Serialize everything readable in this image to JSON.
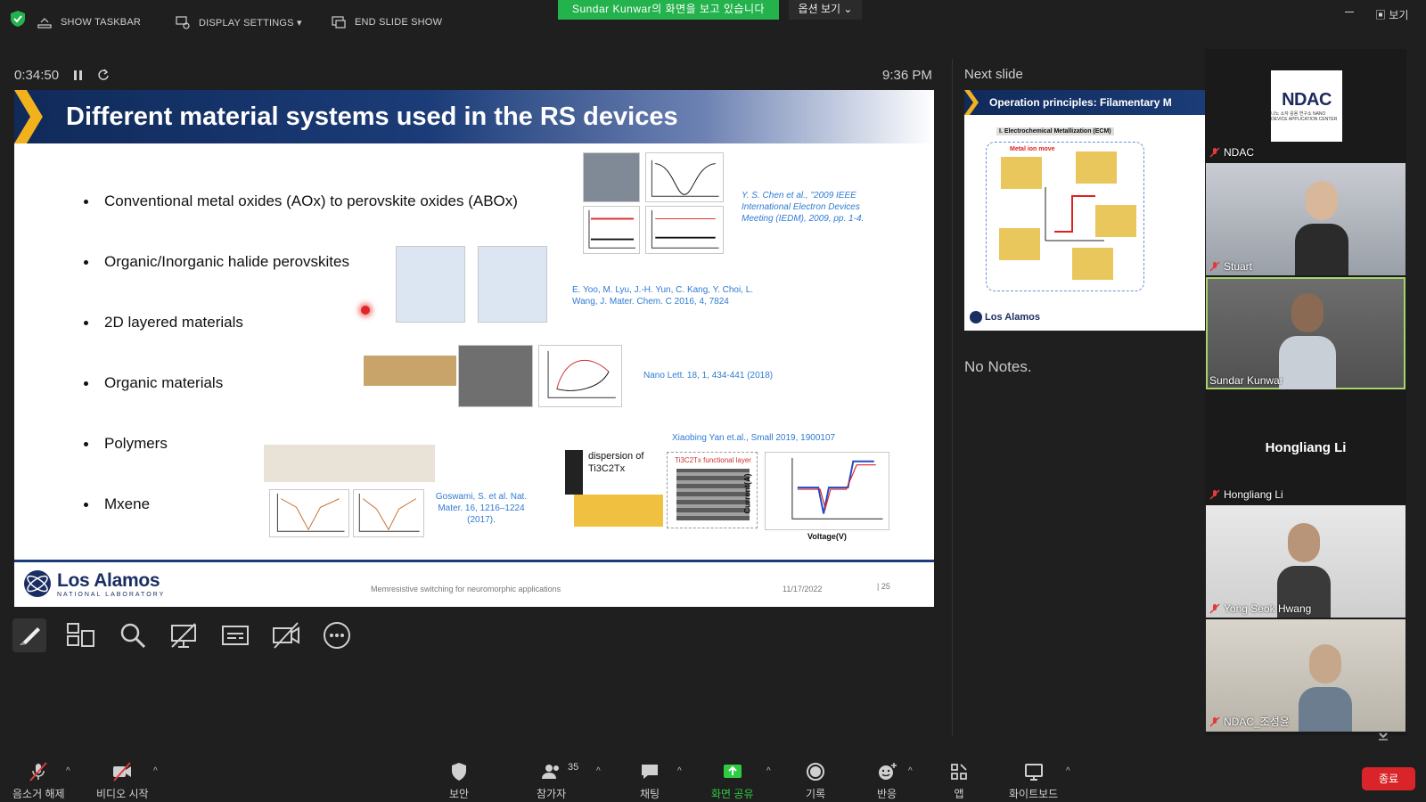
{
  "topbar": {
    "show_taskbar": "SHOW TASKBAR",
    "display_settings": "DISPLAY SETTINGS ▾",
    "end_slide_show": "END SLIDE SHOW",
    "sharing_banner": "Sundar  Kunwar의 화면을 보고 있습니다",
    "view_options": "옵션 보기 ⌄",
    "view_label": "보기"
  },
  "presenter": {
    "elapsed": "0:34:50",
    "clock": "9:36 PM"
  },
  "slide": {
    "title": "Different material systems used in the RS devices",
    "bullets": [
      "Conventional metal oxides (AOx) to perovskite oxides (ABOx)",
      "Organic/Inorganic halide perovskites",
      "2D layered materials",
      "Organic materials",
      "Polymers",
      "Mxene"
    ],
    "citations": {
      "c1": "Y. S. Chen et al., \"2009 IEEE International Electron Devices Meeting (IEDM), 2009, pp. 1-4.",
      "c2": "E. Yoo, M. Lyu, J.-H. Yun, C. Kang, Y. Choi, L. Wang, J. Mater. Chem. C 2016, 4, 7824",
      "c3": "Nano Lett. 18, 1, 434-441 (2018)",
      "c4": "Xiaobing Yan et.al., Small 2019, 1900107",
      "c5": "Goswami, S. et al. Nat. Mater. 16, 1216–1224 (2017)."
    },
    "figure_labels": {
      "dispersion": "dispersion of Ti3C2Tx",
      "functional_layer": "Ti3C2Tx functional layer",
      "voltage_axis": "Voltage(V)",
      "current_axis": "Current(A)"
    },
    "footer": {
      "org": "Los Alamos",
      "org_sub": "NATIONAL LABORATORY",
      "talk": "Memresistive switching for neuromorphic applications",
      "date": "11/17/2022",
      "page": "| 25"
    }
  },
  "next_slide": {
    "label": "Next slide",
    "title": "Operation principles: Filamentary M",
    "sub": "I. Electrochemical Metallization (ECM)",
    "metal_ion": "Metal ion move",
    "org": "Los Alamos"
  },
  "notes": "No Notes.",
  "participants": [
    {
      "name": "NDAC",
      "logo_text": "NDAC",
      "logo_sub": "나노 소자 응용 연구소 NANO DEVICE APPLICATION CENTER"
    },
    {
      "name": "Stuart"
    },
    {
      "name": "Sundar Kunwar"
    },
    {
      "name": "Hongliang Li",
      "display": "Hongliang Li"
    },
    {
      "name": "Yong Seok Hwang"
    },
    {
      "name": "NDAC_조성윤"
    }
  ],
  "bottombar": {
    "mute": "음소거 해제",
    "video": "비디오 시작",
    "security": "보안",
    "participants": "참가자",
    "participants_count": "35",
    "chat": "채팅",
    "share": "화면 공유",
    "record": "기록",
    "reactions": "반응",
    "apps": "앱",
    "whiteboard": "화이트보드",
    "end": "종료"
  },
  "colors": {
    "sharing_green": "#23b24b",
    "speaking_outline": "#a7d46a",
    "end_red": "#d9252a",
    "slide_navy": "#1b3c78",
    "citation_blue": "#2e7bd3"
  }
}
